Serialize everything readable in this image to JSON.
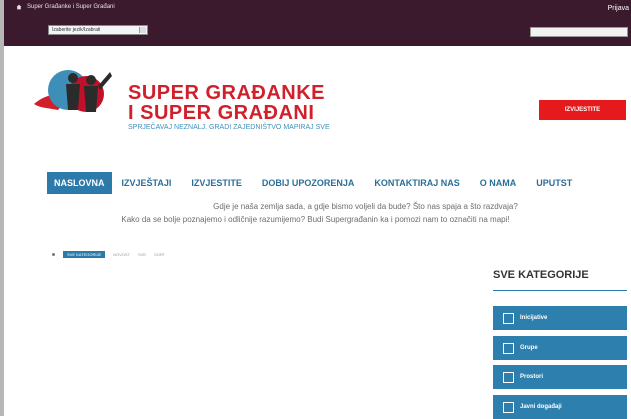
{
  "header": {
    "breadcrumb": "Super Građanke i Super Građani",
    "language_select": "Izaberite jezik/Izabrati",
    "login_label": "Prijava"
  },
  "brand": {
    "line1": "SUPER GRAĐANKE",
    "line2": "I SUPER GRAĐANI",
    "tagline": "SPRJEČAVAJ NEZNALJ. GRADI ZAJEDNIŠTVO MAPIRAJ SVE"
  },
  "report_button": "IZVIJESTITE",
  "nav": {
    "items": [
      "NASLOVNA",
      "IZVJEŠTAJI",
      "IZVJESTITE",
      "DOBIJ UPOZORENJA",
      "KONTAKTIRAJ NAS",
      "O NAMA",
      "UPUTST"
    ]
  },
  "intro": {
    "line1": "Gdje je naša zemlja sada, a gdje bismo voljeli da bude? Što nas spaja a što razdvaja?",
    "line2": "Kako da se bolje poznajemo i odličnije razumijemo? Budi Supergrađanin ka i pomozi nam to označiti na mapi!"
  },
  "filters": {
    "items": [
      "SVE KATEGORIJE",
      "NOVOST",
      "SVE",
      "SORT"
    ]
  },
  "categories": {
    "title": "SVE KATEGORIJE",
    "items": [
      "Inicijative",
      "Grupe",
      "Prostori",
      "Javni događaji"
    ]
  },
  "colors": {
    "topbar": "#3a1a2c",
    "accent_blue": "#2c7aaa",
    "brand_red": "#d0202c"
  }
}
